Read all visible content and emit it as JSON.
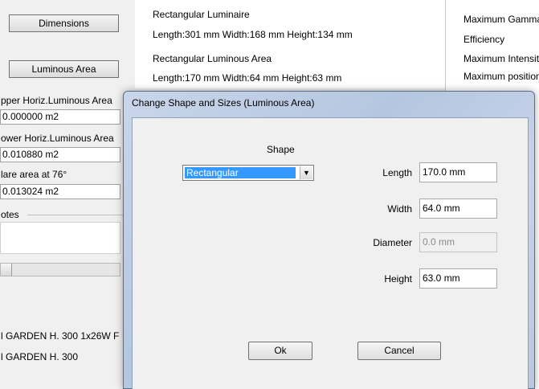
{
  "background": {
    "dimensions_button": "Dimensions",
    "luminous_area_button": "Luminous Area",
    "luminaire_title": "Rectangular Luminaire",
    "luminaire_dims": "Length:301 mm  Width:168 mm  Height:134 mm",
    "luminous_area_title": "Rectangular Luminous Area",
    "luminous_area_dims": "Length:170 mm  Width:64 mm  Height:63 mm",
    "upper_label": "pper Horiz.Luminous Area",
    "upper_value": "0.000000 m2",
    "lower_label": "ower Horiz.Luminous Area",
    "lower_value": "0.010880 m2",
    "glare_label": "lare area at 76°",
    "glare_value": "0.013024 m2",
    "notes_label": "otes",
    "bottom_line1": "l GARDEN H. 300 1x26W F",
    "bottom_line2": "l GARDEN H.  300",
    "right_items": [
      "Maximum Gamma",
      "Efficiency",
      "Maximum Intensit",
      "Maximum position"
    ]
  },
  "dialog": {
    "title": "Change Shape and Sizes (Luminous Area)",
    "shape_label": "Shape",
    "shape_value": "Rectangular",
    "length_label": "Length",
    "length_value": "170.0 mm",
    "width_label": "Width",
    "width_value": "64.0 mm",
    "diameter_label": "Diameter",
    "diameter_value": "0.0 mm",
    "height_label": "Height",
    "height_value": "63.0 mm",
    "ok_label": "Ok",
    "cancel_label": "Cancel"
  }
}
